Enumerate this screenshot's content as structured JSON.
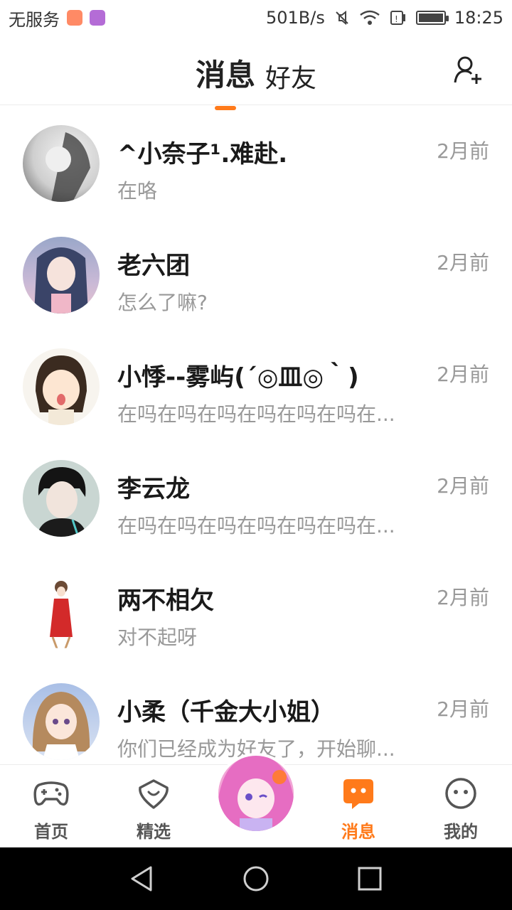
{
  "status_bar": {
    "carrier": "无服务",
    "network_speed": "501B/s",
    "time": "18:25",
    "battery_level": 0.9,
    "icons": [
      "mail-icon",
      "gallery-icon",
      "mute-icon",
      "wifi-icon",
      "sim-icon",
      "battery-icon"
    ],
    "colors": {
      "mail": "#ff8a65",
      "gallery": "#b46cd6"
    }
  },
  "header": {
    "tabs": [
      {
        "label": "消息",
        "active": true
      },
      {
        "label": "好友",
        "active": false
      }
    ],
    "add_friend_icon": "add-user-icon",
    "accent": "#ff7a1a"
  },
  "conversations": [
    {
      "name": "^小奈子¹.难赴.",
      "preview": "在咯",
      "time": "2月前",
      "avatar": "avatar-1"
    },
    {
      "name": "老六团",
      "preview": "怎么了嘛?",
      "time": "2月前",
      "avatar": "avatar-2"
    },
    {
      "name": "小悸--雾屿(´◎皿◎｀)",
      "preview": "在吗在吗在吗在吗在吗在吗在...",
      "time": "2月前",
      "avatar": "avatar-3"
    },
    {
      "name": "李云龙",
      "preview": "在吗在吗在吗在吗在吗在吗在...",
      "time": "2月前",
      "avatar": "avatar-4"
    },
    {
      "name": "两不相欠",
      "preview": "对不起呀",
      "time": "2月前",
      "avatar": "avatar-5"
    },
    {
      "name": "小柔（千金大小姐）",
      "preview": "你们已经成为好友了，开始聊...",
      "time": "2月前",
      "avatar": "avatar-6"
    }
  ],
  "bottom_nav": {
    "items": [
      {
        "label": "首页",
        "icon": "gamepad-icon",
        "active": false
      },
      {
        "label": "精选",
        "icon": "heart-badge-icon",
        "active": false
      },
      {
        "label": "消息",
        "icon": "chat-icon",
        "active": true
      },
      {
        "label": "我的",
        "icon": "smile-icon",
        "active": false
      }
    ]
  },
  "system_nav": {
    "buttons": [
      "back-icon",
      "home-icon",
      "recents-icon"
    ]
  }
}
